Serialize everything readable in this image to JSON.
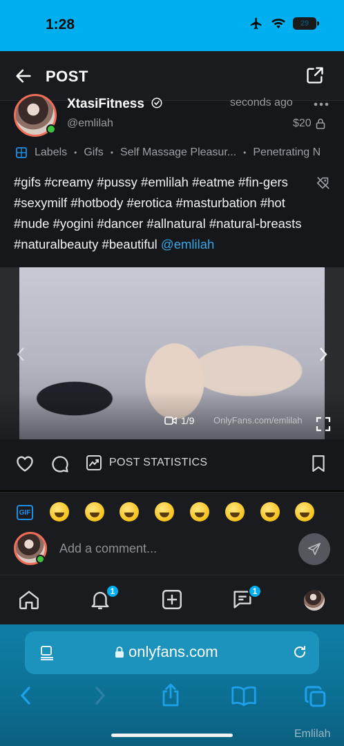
{
  "status_bar": {
    "time": "1:28",
    "battery": "29"
  },
  "header": {
    "title": "POST"
  },
  "post": {
    "author_name": "XtasiFitness",
    "author_handle": "@emlilah",
    "time": "seconds ago",
    "price": "$20",
    "labels": [
      "Labels",
      "Gifs",
      "Self Massage Pleasur...",
      "Penetrating N"
    ],
    "caption": "#gifs #creamy #pussy #emlilah #eatme #fin-gers #sexymilf #hotbody #erotica #masturbation #hot #nude #yogini #dancer #allnatural #natural-breasts #naturalbeauty #beautiful",
    "mention": "@emlilah"
  },
  "media": {
    "counter": "1/9",
    "watermark": "OnlyFans.com/emlilah"
  },
  "actions": {
    "stats_label": "POST STATISTICS"
  },
  "emoji_bar": {
    "gif_label": "GIF"
  },
  "comment": {
    "placeholder": "Add a comment..."
  },
  "app_nav": {
    "notifications_badge": "1",
    "messages_badge": "1"
  },
  "browser": {
    "domain": "onlyfans.com"
  },
  "corner_watermark": "Emlilah",
  "colors": {
    "status_bar": "#00aff0",
    "avatar_ring": "#ef6e58",
    "online": "#3ec33e",
    "mention": "#36a8e8",
    "badge": "#00aff0"
  }
}
